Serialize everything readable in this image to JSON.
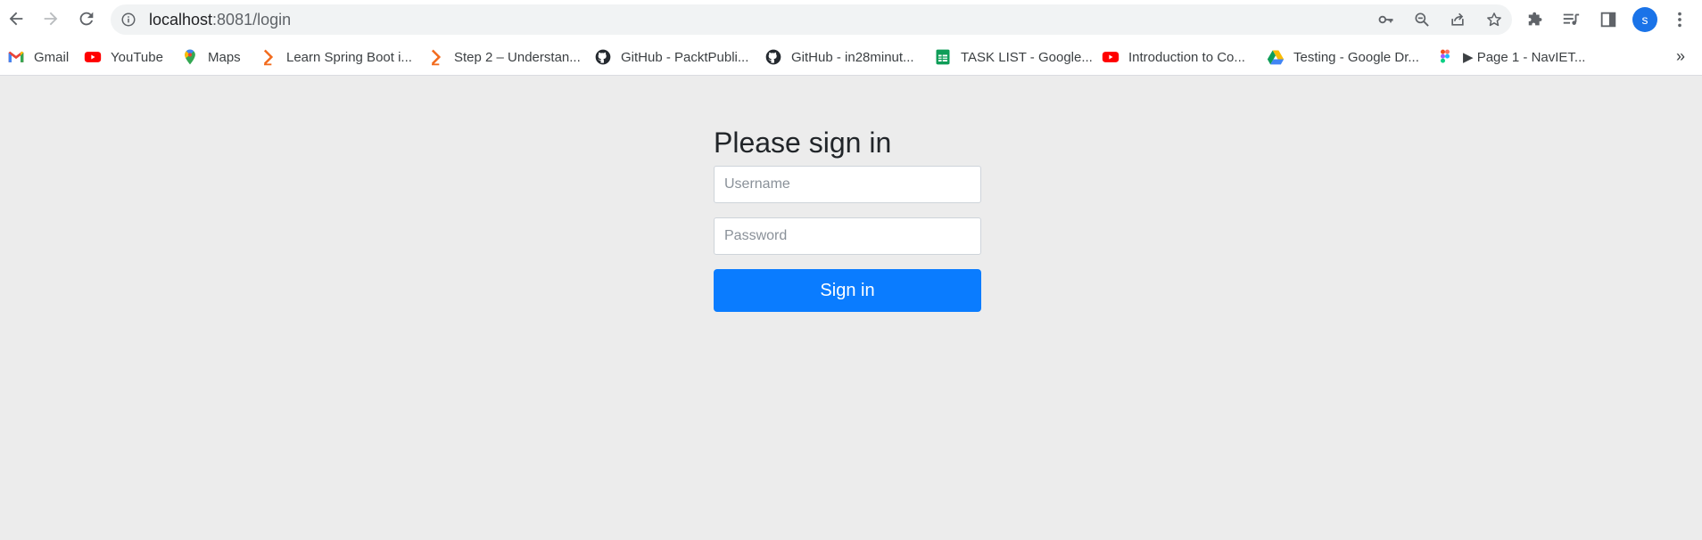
{
  "browser": {
    "url_host": "localhost",
    "url_path": ":8081/login",
    "avatar_letter": "s",
    "icons": [
      "back-arrow-icon",
      "forward-arrow-icon",
      "reload-icon",
      "site-info-icon",
      "key-icon",
      "zoom-out-icon",
      "share-icon",
      "star-icon",
      "extensions-puzzle-icon",
      "reading-list-icon",
      "side-panel-icon",
      "kebab-menu-icon"
    ]
  },
  "bookmarks": [
    {
      "label": "Gmail",
      "icon": "gmail-icon"
    },
    {
      "label": "YouTube",
      "icon": "youtube-icon"
    },
    {
      "label": "Maps",
      "icon": "maps-pin-icon"
    },
    {
      "label": "Learn Spring Boot i...",
      "icon": "chevron-bookmark-icon"
    },
    {
      "label": "Step 2 – Understan...",
      "icon": "chevron-bookmark-icon"
    },
    {
      "label": "GitHub - PacktPubli...",
      "icon": "github-icon"
    },
    {
      "label": "GitHub - in28minut...",
      "icon": "github-icon"
    },
    {
      "label": "TASK LIST - Google...",
      "icon": "google-sheets-icon"
    },
    {
      "label": "Introduction to Co...",
      "icon": "youtube-icon"
    },
    {
      "label": "Testing - Google Dr...",
      "icon": "google-drive-icon"
    },
    {
      "label": "▶ Page 1 - NavIET...",
      "icon": "figma-icon"
    }
  ],
  "bookmarks_more": "»",
  "login": {
    "heading": "Please sign in",
    "username_placeholder": "Username",
    "password_placeholder": "Password",
    "submit_label": "Sign in"
  },
  "colors": {
    "page_background": "#ececec",
    "button": "#0a7cff",
    "avatar": "#1a73e8"
  }
}
